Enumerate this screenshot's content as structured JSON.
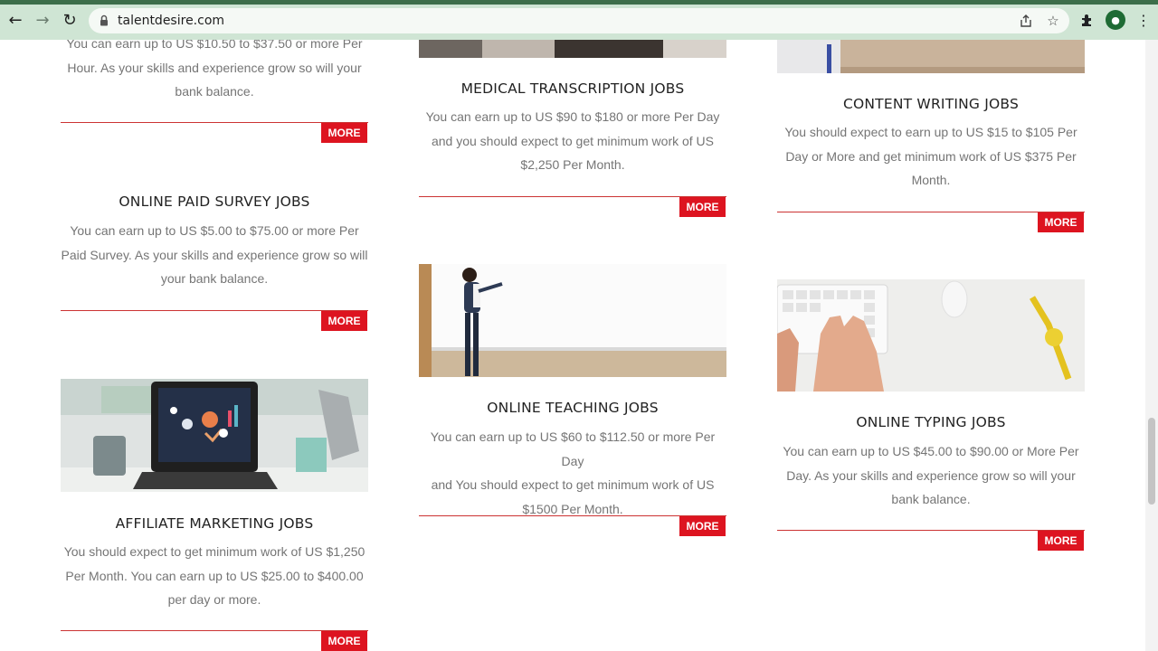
{
  "browser": {
    "url": "talentdesire.com",
    "icons": [
      "back-icon",
      "forward-icon",
      "reload-icon",
      "lock-icon",
      "share-icon",
      "star-icon",
      "extensions-icon",
      "profile-avatar",
      "menu-icon"
    ]
  },
  "jobs": {
    "col1": [
      {
        "title": "",
        "lines": [
          "You can earn up to US $10.50 to $37.50 or more Per",
          "Hour. As your skills and experience grow so will your",
          "bank balance."
        ],
        "more": "MORE"
      },
      {
        "title": "ONLINE PAID SURVEY JOBS",
        "lines": [
          "You can earn up to US $5.00 to $75.00 or more Per",
          "Paid Survey. As your skills and experience grow so will",
          "your bank balance."
        ],
        "more": "MORE"
      },
      {
        "title": "AFFILIATE MARKETING JOBS",
        "lines": [
          "You should expect to get minimum work of US $1,250",
          "Per Month. You can earn up to US $25.00 to $400.00",
          "per day or more."
        ],
        "more": "MORE"
      }
    ],
    "col2": [
      {
        "title": "MEDICAL TRANSCRIPTION JOBS",
        "lines": [
          "You can earn up to US $90 to $180 or more Per Day",
          "and you should expect to get minimum work of US",
          "$2,250 Per Month."
        ],
        "more": "MORE"
      },
      {
        "title": "ONLINE TEACHING JOBS",
        "lines": [
          "You can earn up to US $60 to $112.50 or more Per Day",
          "and You should expect to get minimum work of US",
          "$1500 Per Month."
        ],
        "more": "MORE"
      }
    ],
    "col3": [
      {
        "title": "CONTENT WRITING JOBS",
        "lines": [
          "You should expect to earn up to US $15 to $105 Per",
          "Day or More and get minimum work of US $375 Per",
          "Month."
        ],
        "more": "MORE"
      },
      {
        "title": "ONLINE TYPING JOBS",
        "lines": [
          "You can earn up to US $45.00 to $90.00 or More Per",
          "Day. As your skills and experience grow so will your",
          "bank balance."
        ],
        "more": "MORE"
      }
    ]
  },
  "colors": {
    "accent": "#dd1420",
    "rule": "#cc3333",
    "text": "#757575",
    "chrome": "#cfe5d4"
  }
}
